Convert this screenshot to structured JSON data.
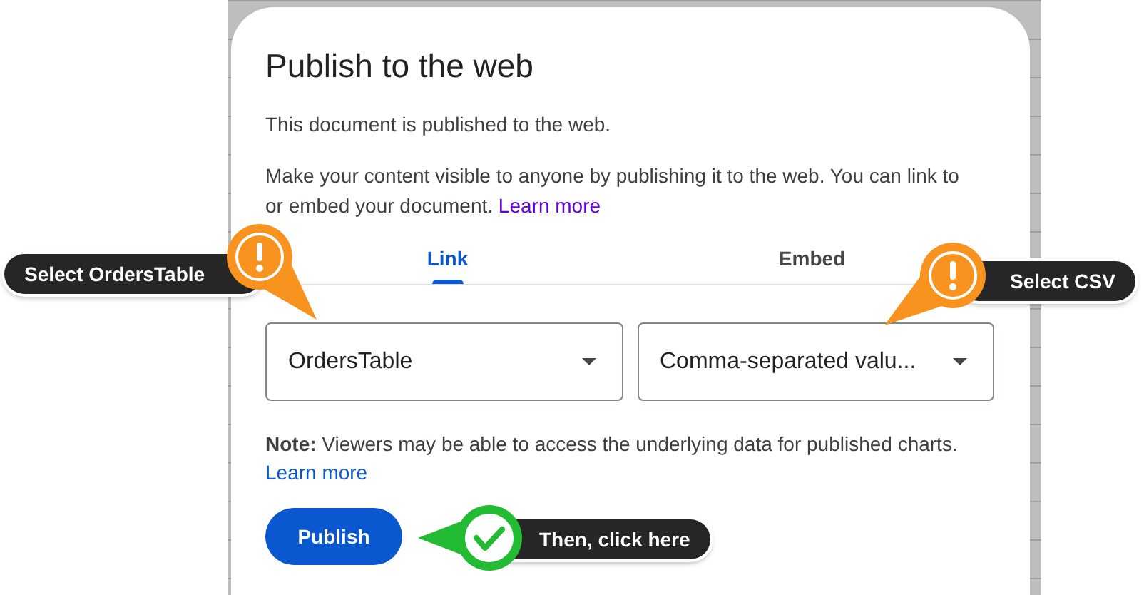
{
  "dialog": {
    "title": "Publish to the web",
    "status": "This document is published to the web.",
    "description": "Make your content visible to anyone by publishing it to the web. You can link to or embed your document.",
    "description_link": "Learn more",
    "tabs": [
      {
        "label": "Link",
        "selected": true
      },
      {
        "label": "Embed",
        "selected": false
      }
    ],
    "dropdowns": [
      {
        "value": "OrdersTable"
      },
      {
        "value": "Comma-separated valu..."
      }
    ],
    "note": "**Note:** Viewers may be able to access the underlying data for published charts.",
    "note_link": "Learn more",
    "button": "Publish"
  },
  "callouts": [
    {
      "kind": "warning",
      "text": "Select OrdersTable"
    },
    {
      "kind": "warning",
      "text": "Select CSV"
    },
    {
      "kind": "success",
      "text": "Then, click here"
    }
  ]
}
